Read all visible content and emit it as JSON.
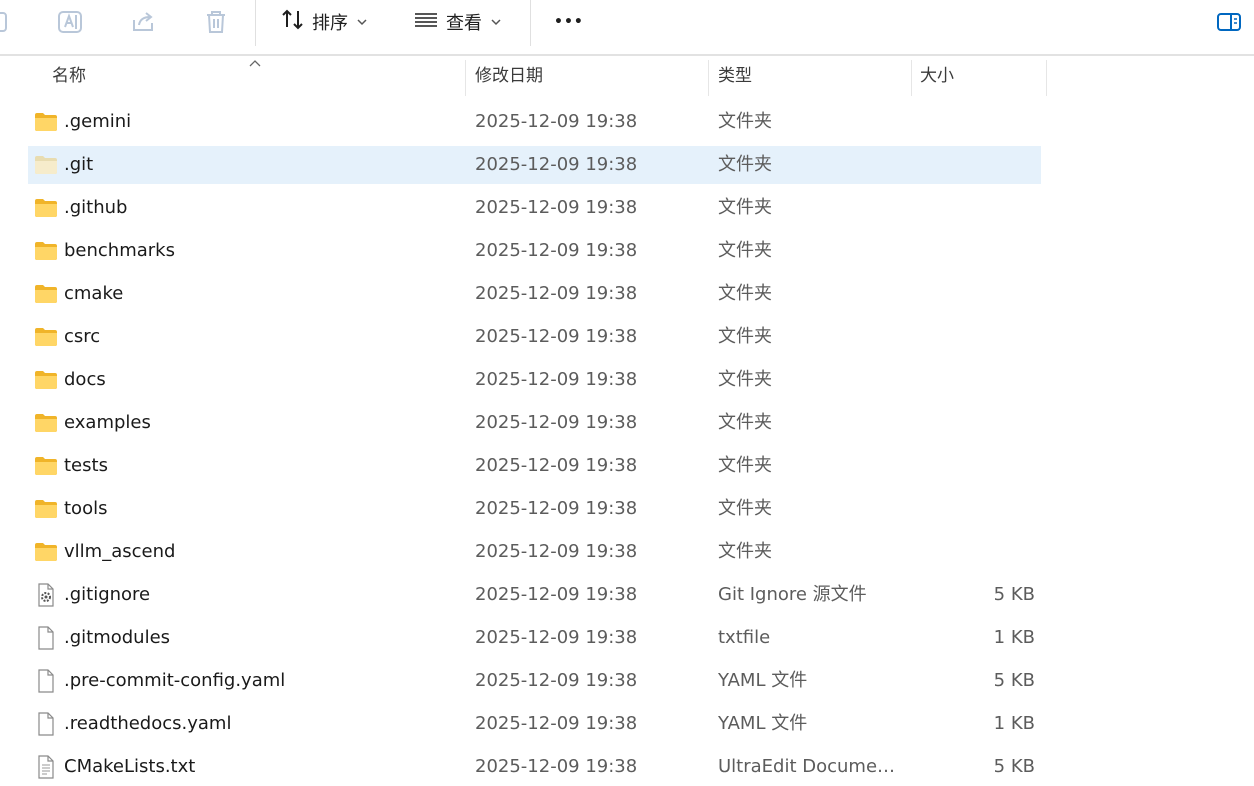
{
  "toolbar": {
    "sort_label": "排序",
    "view_label": "查看",
    "more_label": "•••"
  },
  "columns": {
    "name": "名称",
    "date": "修改日期",
    "type": "类型",
    "size": "大小"
  },
  "colors": {
    "selected_row": "#e5f1fb",
    "folder": "#f5c13b"
  },
  "files": [
    {
      "name": ".gemini",
      "date": "2025-12-09 19:38",
      "type": "文件夹",
      "size": "",
      "icon": "folder-icon"
    },
    {
      "name": ".git",
      "date": "2025-12-09 19:38",
      "type": "文件夹",
      "size": "",
      "icon": "folder-icon",
      "selected": true
    },
    {
      "name": ".github",
      "date": "2025-12-09 19:38",
      "type": "文件夹",
      "size": "",
      "icon": "folder-icon"
    },
    {
      "name": "benchmarks",
      "date": "2025-12-09 19:38",
      "type": "文件夹",
      "size": "",
      "icon": "folder-icon"
    },
    {
      "name": "cmake",
      "date": "2025-12-09 19:38",
      "type": "文件夹",
      "size": "",
      "icon": "folder-icon"
    },
    {
      "name": "csrc",
      "date": "2025-12-09 19:38",
      "type": "文件夹",
      "size": "",
      "icon": "folder-icon"
    },
    {
      "name": "docs",
      "date": "2025-12-09 19:38",
      "type": "文件夹",
      "size": "",
      "icon": "folder-icon"
    },
    {
      "name": "examples",
      "date": "2025-12-09 19:38",
      "type": "文件夹",
      "size": "",
      "icon": "folder-icon"
    },
    {
      "name": "tests",
      "date": "2025-12-09 19:38",
      "type": "文件夹",
      "size": "",
      "icon": "folder-icon"
    },
    {
      "name": "tools",
      "date": "2025-12-09 19:38",
      "type": "文件夹",
      "size": "",
      "icon": "folder-icon"
    },
    {
      "name": "vllm_ascend",
      "date": "2025-12-09 19:38",
      "type": "文件夹",
      "size": "",
      "icon": "folder-icon"
    },
    {
      "name": ".gitignore",
      "date": "2025-12-09 19:38",
      "type": "Git Ignore 源文件",
      "size": "5 KB",
      "icon": "gear-file-icon"
    },
    {
      "name": ".gitmodules",
      "date": "2025-12-09 19:38",
      "type": "txtfile",
      "size": "1 KB",
      "icon": "file-icon"
    },
    {
      "name": ".pre-commit-config.yaml",
      "date": "2025-12-09 19:38",
      "type": "YAML 文件",
      "size": "5 KB",
      "icon": "file-icon"
    },
    {
      "name": ".readthedocs.yaml",
      "date": "2025-12-09 19:38",
      "type": "YAML 文件",
      "size": "1 KB",
      "icon": "file-icon"
    },
    {
      "name": "CMakeLists.txt",
      "date": "2025-12-09 19:38",
      "type": "UltraEdit Documen...",
      "size": "5 KB",
      "icon": "text-file-icon"
    }
  ]
}
